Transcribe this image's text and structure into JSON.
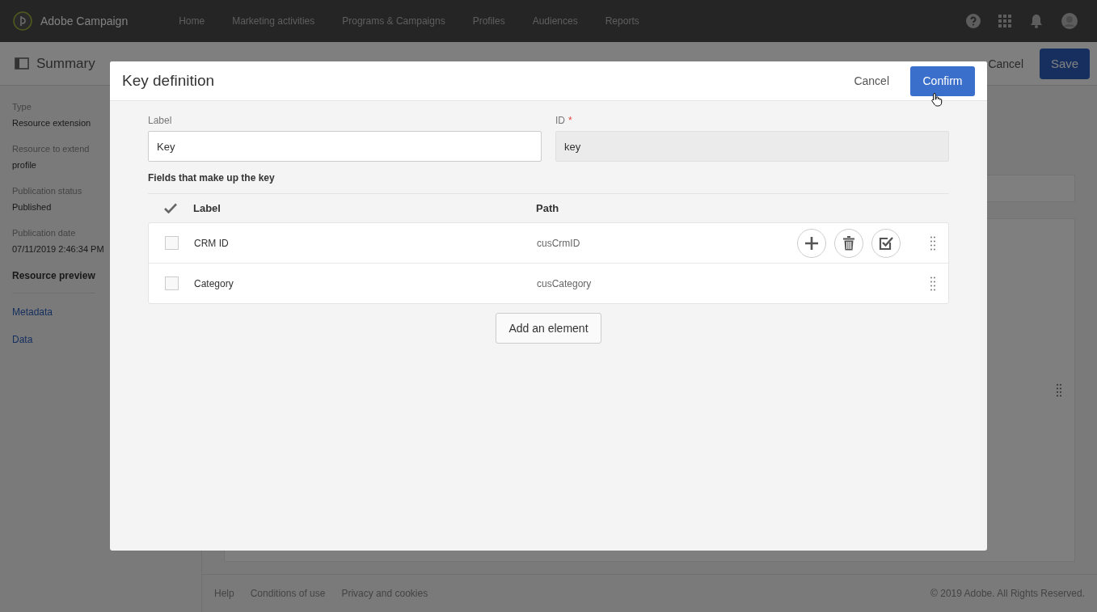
{
  "topbar": {
    "brand": "Adobe Campaign",
    "menu": [
      {
        "label": "Home"
      },
      {
        "label": "Marketing activities"
      },
      {
        "label": "Programs & Campaigns"
      },
      {
        "label": "Profiles"
      },
      {
        "label": "Audiences"
      },
      {
        "label": "Reports"
      }
    ]
  },
  "header": {
    "title": "Summary",
    "cancel": "Cancel",
    "save": "Save"
  },
  "sidebar": {
    "properties": [
      {
        "name": "Type",
        "value": "Resource extension"
      },
      {
        "name": "Resource to extend",
        "value": "profile"
      },
      {
        "name": "Publication status",
        "value": "Published"
      },
      {
        "name": "Publication date",
        "value": "07/11/2019 2:46:34 PM"
      }
    ],
    "section": "Resource preview",
    "links": [
      "Metadata",
      "Data"
    ]
  },
  "footer": {
    "links": [
      "Help",
      "Conditions of use",
      "Privacy and cookies"
    ],
    "copyright": "© 2019 Adobe. All Rights Reserved."
  },
  "dialog": {
    "title": "Key definition",
    "cancel": "Cancel",
    "confirm": "Confirm",
    "label_field": {
      "label": "Label",
      "value": "Key"
    },
    "id_field": {
      "label": "ID",
      "required_mark": "*",
      "value": "key",
      "disabled": true
    },
    "section_title": "Fields that make up the key",
    "columns": [
      "Label",
      "Path"
    ],
    "rows": [
      {
        "label": "CRM ID",
        "path": "cusCrmID",
        "checked": false,
        "hovered": true
      },
      {
        "label": "Category",
        "path": "cusCategory",
        "checked": false,
        "hovered": false
      }
    ],
    "add_button": "Add an element"
  }
}
